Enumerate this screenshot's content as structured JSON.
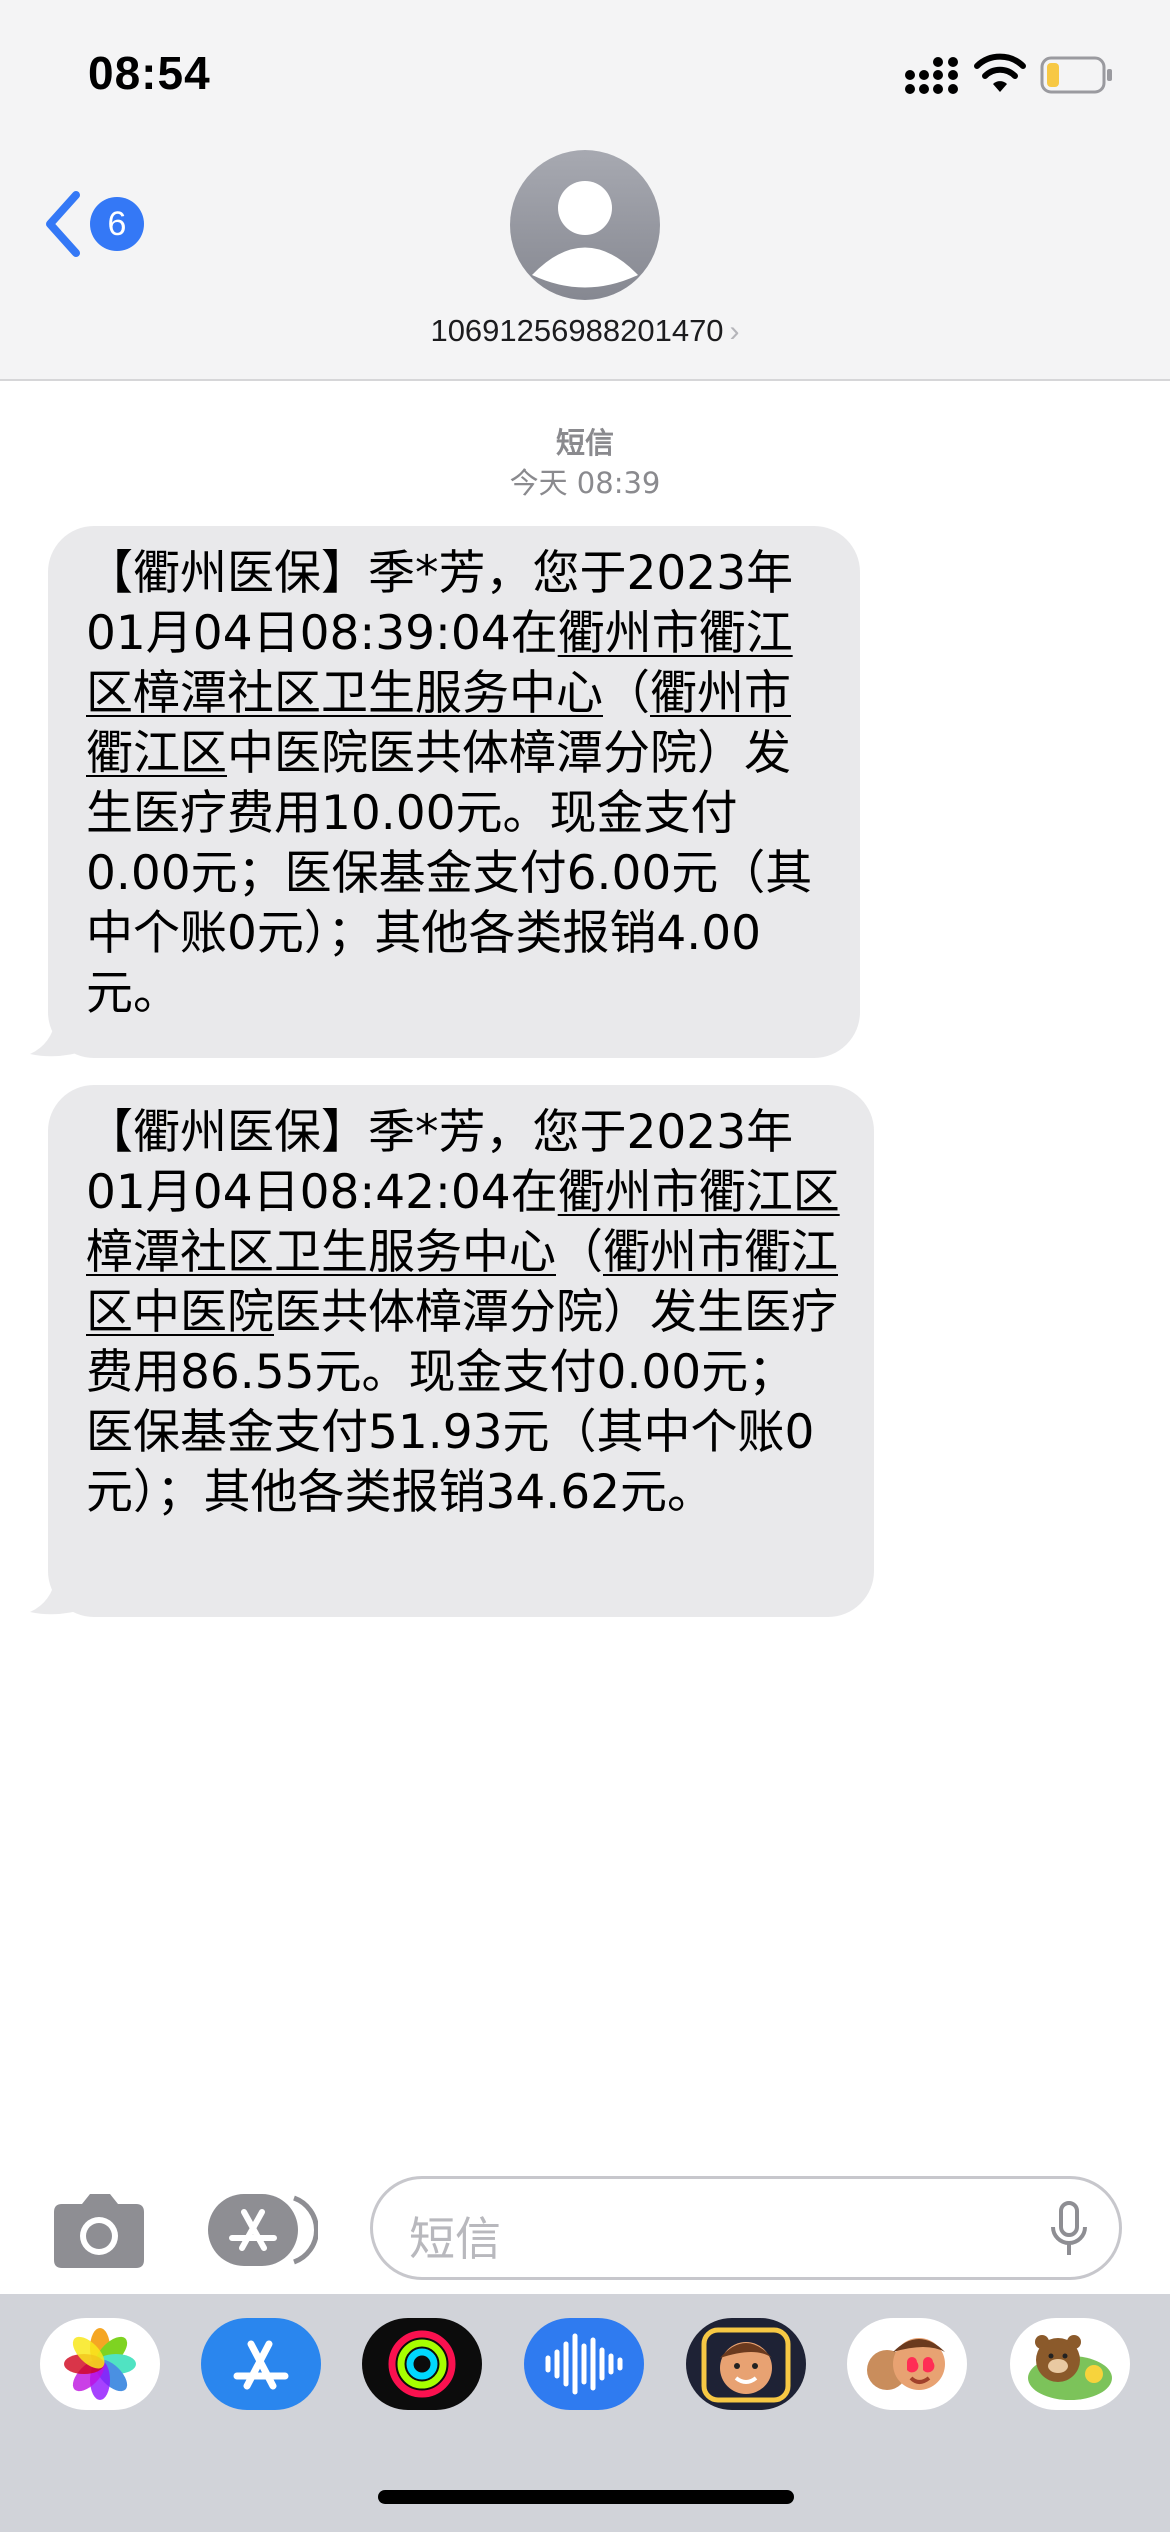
{
  "status_bar": {
    "time": "08:54"
  },
  "header": {
    "back_badge_count": "6",
    "contact": "10691256988201470",
    "contact_chevron": "›"
  },
  "conversation": {
    "service": "短信",
    "timestamp": "今天 08:39",
    "messages": [
      {
        "pre": "【衢州医保】季*芳，您于2023年01月04日08:39:04在",
        "link1": "衢州市衢江区樟潭社区卫生服务中心",
        "mid": "（",
        "link2": "衢州市衢江区",
        "post": "中医院医共体樟潭分院）发生医疗费用10.00元。现金支付0.00元；医保基金支付6.00元（其中个账0元）；其他各类报销4.00元。"
      },
      {
        "pre": "【衢州医保】季*芳，您于2023年01月04日08:42:04在",
        "link1": "衢州市衢江区樟潭社区卫生服务中心",
        "mid": "（",
        "link2": "衢州市衢江区中医院",
        "post": "医共体樟潭分院）发生医疗费用86.55元。现金支付0.00元；医保基金支付51.93元（其中个账0元）；其他各类报销34.62元。"
      }
    ]
  },
  "input": {
    "placeholder": "短信"
  },
  "icons": {
    "camera": "camera-icon",
    "apps": "app-store-icon",
    "mic": "microphone-icon",
    "drawer": [
      "photos-icon",
      "app-store-icon",
      "activity-icon",
      "audio-message-icon",
      "memoji-icon",
      "memoji-stickers-icon",
      "line-friends-stickers-icon"
    ]
  },
  "colors": {
    "accent": "#3478f6",
    "bubble": "#e9e9eb",
    "header_bg": "#f4f4f5",
    "drawer_bg": "#d1d3d9"
  }
}
